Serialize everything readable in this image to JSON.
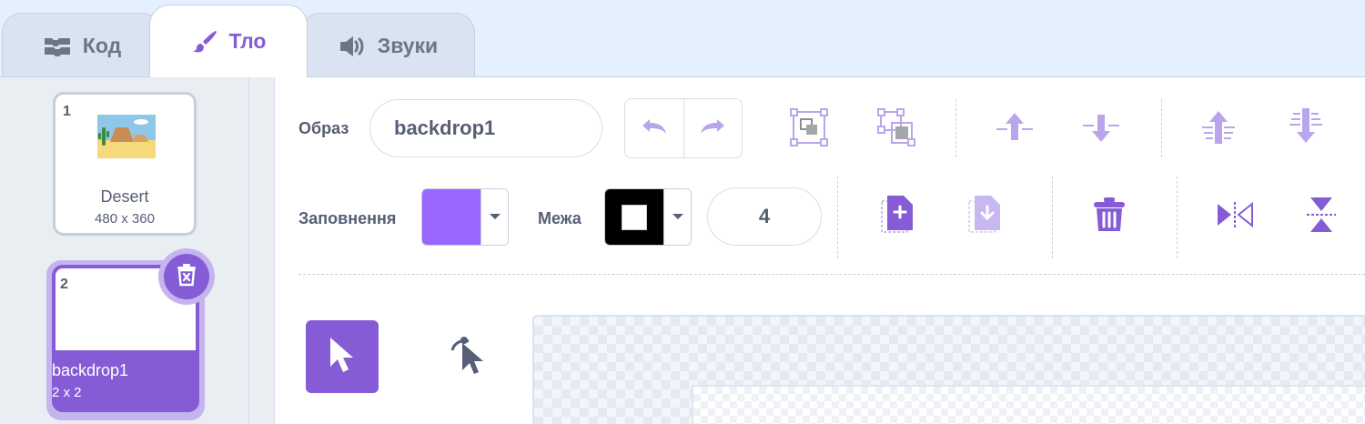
{
  "tabs": [
    {
      "label": "Код",
      "icon": "code-blocks-icon"
    },
    {
      "label": "Тло",
      "icon": "paintbrush-icon",
      "selected": true
    },
    {
      "label": "Звуки",
      "icon": "speaker-icon"
    }
  ],
  "backdrops": [
    {
      "number": "1",
      "name": "Desert",
      "size": "480 x 360",
      "selected": false
    },
    {
      "number": "2",
      "name": "backdrop1",
      "size": "2 x 2",
      "selected": true
    }
  ],
  "editor": {
    "costume_label": "Образ",
    "costume_name": "backdrop1",
    "fill_label": "Заповнення",
    "outline_label": "Межа",
    "outline_width": "4"
  },
  "colors": {
    "accent": "#855cd6",
    "fill": "#9966ff",
    "outline": "#000000",
    "accent_light": "#c6b4ee"
  }
}
